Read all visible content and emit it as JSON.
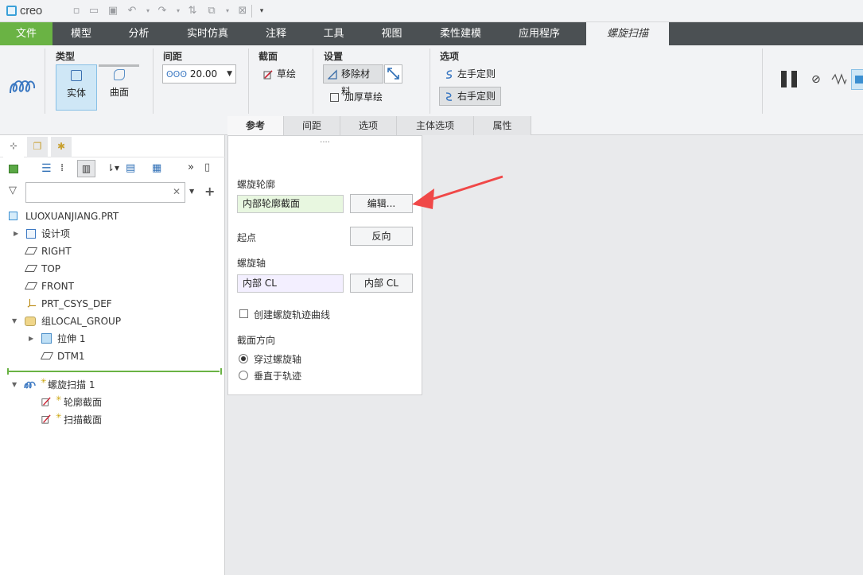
{
  "app": {
    "logo": "creo"
  },
  "ribbon_tabs": [
    "文件",
    "模型",
    "分析",
    "实时仿真",
    "注释",
    "工具",
    "视图",
    "柔性建模",
    "应用程序",
    "螺旋扫描"
  ],
  "ribbon": {
    "type_title": "类型",
    "solid_label": "实体",
    "surface_label": "曲面",
    "pitch_title": "间距",
    "pitch_value": "20.00",
    "section_title": "截面",
    "sketch_label": "草绘",
    "settings_title": "设置",
    "remove_material_label": "移除材料",
    "thicken_sketch_label": "加厚草绘",
    "options_title": "选项",
    "left_hand_label": "左手定则",
    "right_hand_label": "右手定则"
  },
  "subtabs": [
    "参考",
    "间距",
    "选项",
    "主体选项",
    "属性"
  ],
  "tree": {
    "search_placeholder": "",
    "items": {
      "root": "LUOXUANJIANG.PRT",
      "design_items": "设计项",
      "right": "RIGHT",
      "top": "TOP",
      "front": "FRONT",
      "csys": "PRT_CSYS_DEF",
      "group": "组LOCAL_GROUP",
      "extrude": "拉伸 1",
      "dtm": "DTM1",
      "helical": "螺旋扫描 1",
      "profile": "轮廓截面",
      "sweep": "扫描截面"
    }
  },
  "panel": {
    "dots": "....",
    "profile_label": "螺旋轮廓",
    "profile_value": "内部轮廓截面",
    "edit_button": "编辑...",
    "start_label": "起点",
    "reverse_button": "反向",
    "axis_label": "螺旋轴",
    "axis_value": "内部 CL",
    "axis_button": "内部 CL",
    "create_curve_label": "创建螺旋轨迹曲线",
    "create_curve_checked": false,
    "section_dir_label": "截面方向",
    "through_axis_label": "穿过螺旋轴",
    "normal_traj_label": "垂直于轨迹",
    "selected_direction": "穿过螺旋轴"
  },
  "colors": {
    "file_tab": "#6ab344",
    "tab_bar": "#4b5053",
    "arrow": "#f04848",
    "selection": "#cfe7f6"
  }
}
